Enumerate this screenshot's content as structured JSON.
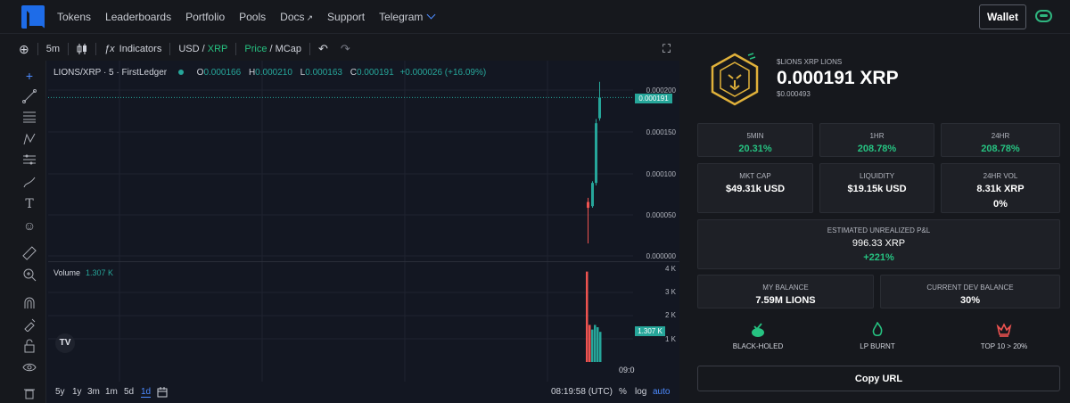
{
  "nav": {
    "links": [
      "Tokens",
      "Leaderboards",
      "Portfolio",
      "Pools",
      "Docs",
      "Support",
      "Telegram"
    ],
    "wallet_label": "Wallet"
  },
  "toolbar": {
    "interval": "5m",
    "indicators": "Indicators",
    "currency_a": "USD",
    "currency_b": "XRP",
    "price_mode_a": "Price",
    "price_mode_b": "MCap"
  },
  "chart": {
    "symbol_line": "LIONS/XRP · 5 · FirstLedger",
    "ohlc": {
      "o": "0.000166",
      "h": "0.000210",
      "l": "0.000163",
      "c": "0.000191",
      "change": "+0.000026 (+16.09%)"
    },
    "volume_label": "Volume",
    "volume_value": "1.307 K",
    "price_tag": "0.000191",
    "vol_tag": "1.307 K",
    "time_label": "09:0",
    "ranges": [
      "5y",
      "1y",
      "3m",
      "1m",
      "5d",
      "1d"
    ],
    "clock": "08:19:58 (UTC)",
    "scale_opts": [
      "%",
      "log",
      "auto"
    ]
  },
  "chart_data": {
    "type": "candlestick",
    "price_axis_ticks": [
      "0.000200",
      "0.000150",
      "0.000100",
      "0.000050",
      "0.000000"
    ],
    "volume_axis_ticks": [
      "4 K",
      "3 K",
      "2 K",
      "1 K"
    ],
    "candles": [
      {
        "o": 6.5e-05,
        "h": 7e-05,
        "l": 1.5e-05,
        "c": 5.8e-05,
        "dir": "down"
      },
      {
        "o": 6e-05,
        "h": 9e-05,
        "l": 5.8e-05,
        "c": 8.8e-05,
        "dir": "up"
      },
      {
        "o": 8.8e-05,
        "h": 0.000165,
        "l": 8.5e-05,
        "c": 0.00016,
        "dir": "up"
      },
      {
        "o": 0.000166,
        "h": 0.00021,
        "l": 0.000163,
        "c": 0.000191,
        "dir": "up"
      }
    ],
    "volumes": [
      {
        "v": 3.9,
        "dir": "down"
      },
      {
        "v": 1.6,
        "dir": "down"
      },
      {
        "v": 1.4,
        "dir": "up"
      },
      {
        "v": 1.6,
        "dir": "up"
      },
      {
        "v": 1.5,
        "dir": "up"
      },
      {
        "v": 1.3,
        "dir": "up"
      }
    ]
  },
  "token": {
    "ticker": "$LIONS XRP LIONS",
    "price": "0.000191 XRP",
    "price_usd": "$0.000493"
  },
  "stats": {
    "m5_label": "5MIN",
    "m5_val": "20.31%",
    "h1_label": "1HR",
    "h1_val": "208.78%",
    "h24_label": "24HR",
    "h24_val": "208.78%",
    "mcap_label": "MKT CAP",
    "mcap_val": "$49.31k USD",
    "liq_label": "LIQUIDITY",
    "liq_val": "$19.15k USD",
    "vol_label": "24HR VOL",
    "vol_val": "8.31k XRP",
    "vol_pct": "0%",
    "pnl_label": "ESTIMATED UNREALIZED P&L",
    "pnl_val": "996.33 XRP",
    "pnl_pct": "+221%",
    "bal_label": "MY BALANCE",
    "bal_val": "7.59M LIONS",
    "dev_label": "CURRENT DEV BALANCE",
    "dev_val": "30%"
  },
  "badges": {
    "b1": "BLACK-HOLED",
    "b2": "LP BURNT",
    "b3": "TOP 10 > 20%"
  },
  "copy_label": "Copy URL",
  "colors": {
    "up": "#26a69a",
    "down": "#ef5350",
    "accent_green": "#26c281",
    "gold": "#e0b13a"
  }
}
